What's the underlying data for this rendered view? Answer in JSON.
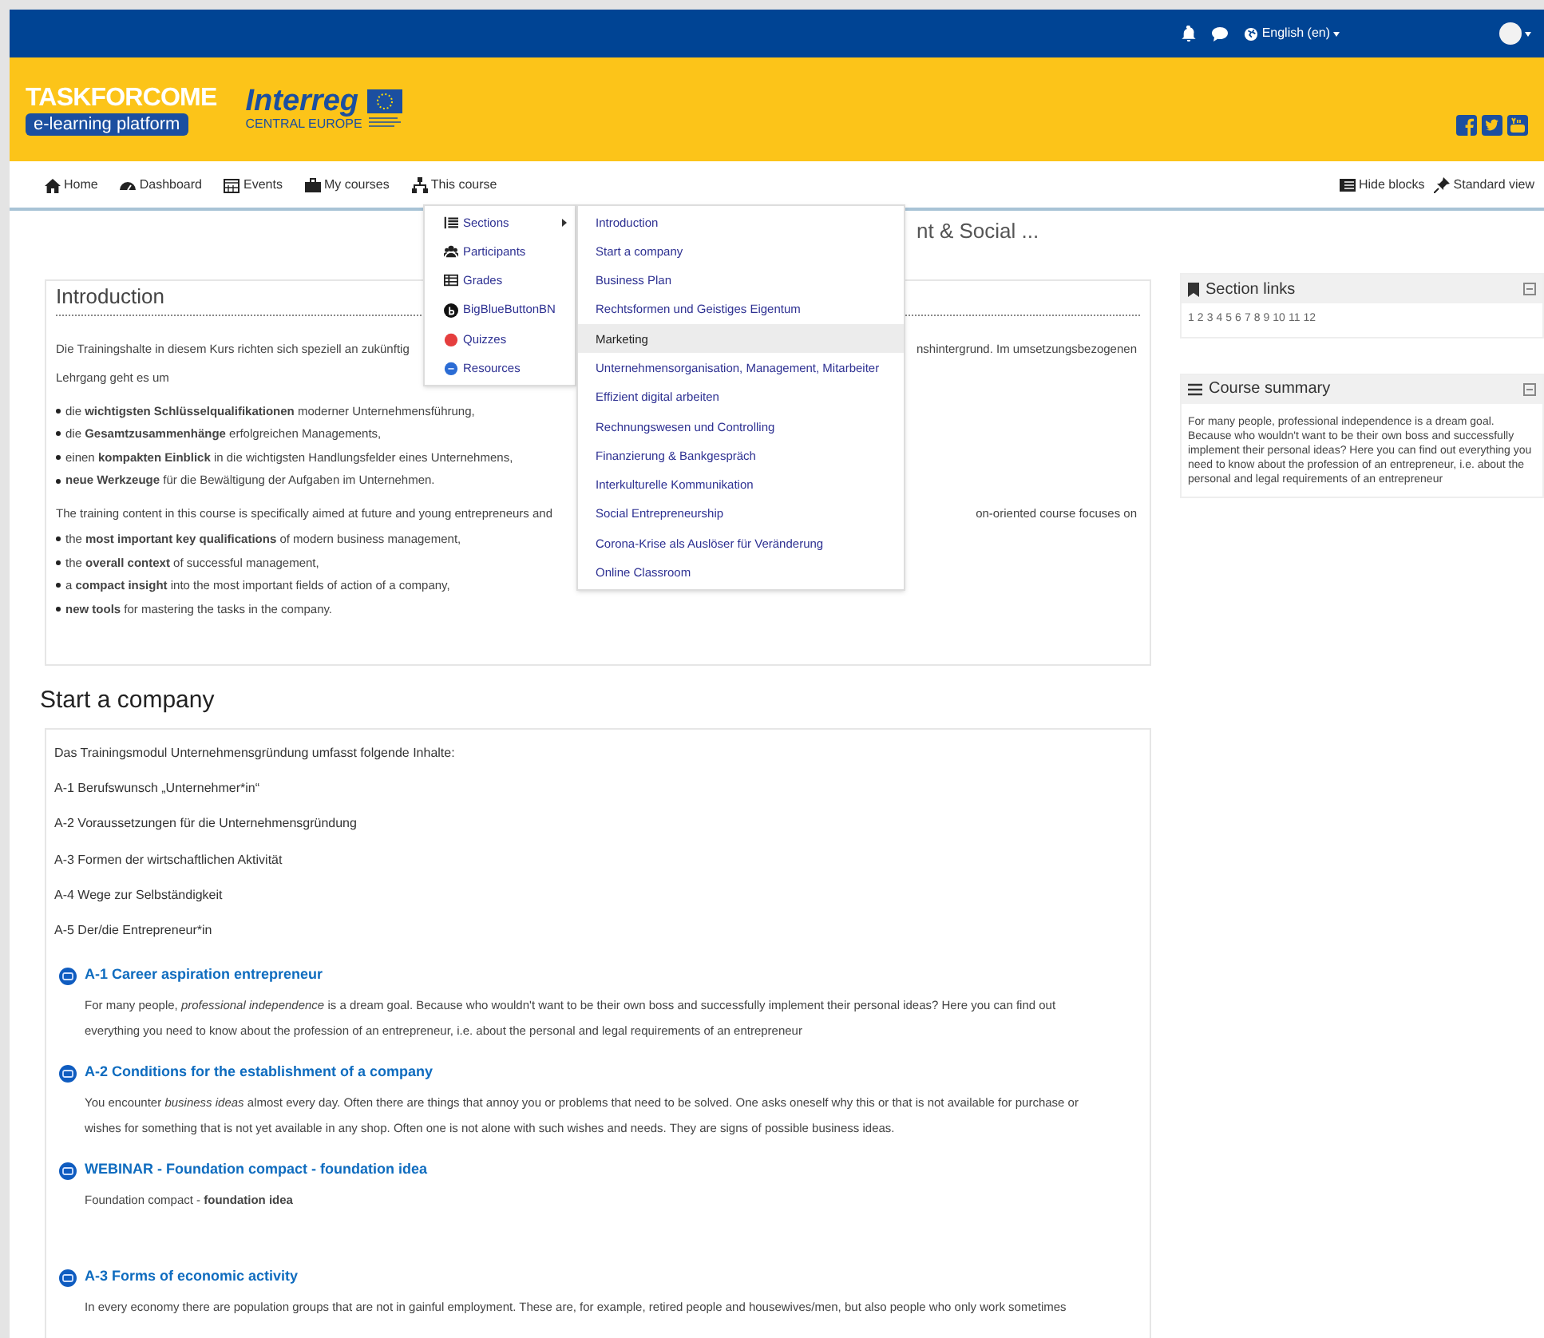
{
  "top_bar": {
    "language": "English (en)"
  },
  "header": {
    "site_name": "TASKFORCOME",
    "tagline": "e-learning platform",
    "partner_name": "Interreg",
    "partner_region": "CENTRAL EUROPE"
  },
  "nav": {
    "items": [
      "Home",
      "Dashboard",
      "Events",
      "My courses",
      "This course"
    ],
    "right_items": [
      "Hide blocks",
      "Standard view"
    ]
  },
  "course_menu": [
    {
      "label": "Sections",
      "kind": "submenu"
    },
    {
      "label": "Participants",
      "kind": "link"
    },
    {
      "label": "Grades",
      "kind": "link"
    },
    {
      "label": "BigBlueButtonBN",
      "kind": "link"
    },
    {
      "label": "Quizzes",
      "kind": "link"
    },
    {
      "label": "Resources",
      "kind": "link"
    }
  ],
  "sections_menu": [
    {
      "label": "Introduction",
      "selected": false
    },
    {
      "label": "Start a company",
      "selected": false
    },
    {
      "label": "Business Plan",
      "selected": false
    },
    {
      "label": "Rechtsformen und Geistiges Eigentum",
      "selected": false
    },
    {
      "label": "Marketing",
      "selected": true
    },
    {
      "label": "Unternehmensorganisation, Management, Mitarbeiter",
      "selected": false
    },
    {
      "label": "Effizient digital arbeiten",
      "selected": false
    },
    {
      "label": "Rechnungswesen und Controlling",
      "selected": false
    },
    {
      "label": "Finanzierung & Bankgespräch",
      "selected": false
    },
    {
      "label": "Interkulturelle Kommunikation",
      "selected": false
    },
    {
      "label": "Social Entrepreneurship",
      "selected": false
    },
    {
      "label": "Corona-Krise als Auslöser für Veränderung",
      "selected": false
    },
    {
      "label": "Online Classroom",
      "selected": false
    }
  ],
  "page_title": "nt & Social ...",
  "introduction": {
    "title": "Introduction",
    "blocks": [
      {
        "kind": "split_line",
        "left": "Die Trainingshalte in diesem Kurs richten sich speziell an zukünftig",
        "right": "nshintergrund. Im umsetzungsbezogenen"
      },
      {
        "kind": "paragraph",
        "text": "Lehrgang geht es um"
      },
      {
        "kind": "list",
        "items": [
          "die **wichtigsten Schlüsselqualifikationen** moderner Unternehmensführung,",
          "die **Gesamtzusammenhänge** erfolgreichen Managements,",
          "einen **kompakten Einblick** in die wichtigsten Handlungsfelder eines Unternehmens,",
          "**neue Werkzeuge** für die Bewältigung der Aufgaben im Unternehmen."
        ]
      },
      {
        "kind": "split_line",
        "left": "The training content in this course is specifically aimed at future and young entrepreneurs and",
        "right": "on-oriented course focuses on"
      },
      {
        "kind": "list",
        "items": [
          "the **most important key qualifications** of modern business management,",
          "the **overall context** of successful management,",
          "a **compact insight** into the most important fields of action of a company,",
          "**new tools** for mastering the tasks in the company."
        ]
      }
    ]
  },
  "sidebar": {
    "section_links": {
      "title": "Section links",
      "links": [
        "1",
        "2",
        "3",
        "4",
        "5",
        "6",
        "7",
        "8",
        "9",
        "10",
        "11",
        "12"
      ]
    },
    "course_summary": {
      "title": "Course summary",
      "text": "For many people, professional independence is a dream goal. Because who wouldn't want to be their own boss and successfully implement their personal ideas? Here you can find out everything you need to know about the profession of an entrepreneur, i.e. about the personal and legal requirements of an entrepreneur"
    }
  },
  "start_section": {
    "title": "Start a company",
    "lines": [
      "Das Trainingsmodul Unternehmensgründung umfasst folgende Inhalte:",
      "A-1 Berufswunsch „Unternehmer*in“",
      "A-2 Voraussetzungen für die Unternehmensgründung",
      "A-3 Formen der wirtschaftlichen Aktivität",
      "A-4 Wege zur Selbständigkeit",
      "A-5 Der/die Entrepreneur*in"
    ],
    "activities": [
      {
        "title": "A-1 Career aspiration entrepreneur",
        "description": "For many people, *professional independence* is a dream goal. Because who wouldn't want to be their own boss and successfully implement their personal ideas? Here you can find out everything you need to know about the profession of an entrepreneur, i.e. about the personal and legal requirements of an entrepreneur"
      },
      {
        "title": "A-2 Conditions for the establishment of a company",
        "description": "You encounter *business ideas* almost every day. Often there are things that annoy you or problems that need to be solved. One asks oneself why this or that is not available for purchase or wishes for something that is not yet available in any shop. Often one is not alone with such wishes and needs. They are signs of possible business ideas."
      },
      {
        "title": "WEBINAR - Foundation compact - foundation idea",
        "description": "Foundation compact - **foundation idea**"
      },
      {
        "title": "A-3 Forms of economic activity",
        "description": "In every economy there are population groups that are not in gainful employment. These are, for example, retired people and housewives/men, but also people who only work sometimes"
      }
    ]
  }
}
